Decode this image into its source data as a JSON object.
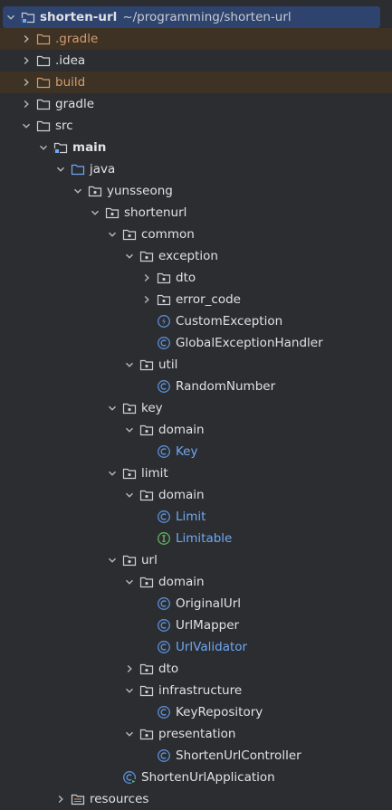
{
  "colors": {
    "background": "#2b2d30",
    "selected": "#2e436e",
    "excluded_row": "#3d3223",
    "excluded_text": "#d39c72",
    "modified_text": "#6fa8f5",
    "class_icon": "#5c8fd6",
    "interface_icon": "#5fb360"
  },
  "tree": {
    "root": {
      "label": "shorten-url",
      "path": "~/programming/shorten-url"
    },
    "gradle_dir": "gradle_dot",
    "items": {
      "gradle_hidden": ".gradle",
      "idea": ".idea",
      "build": "build",
      "gradle": "gradle",
      "src": "src",
      "main": "main",
      "java": "java",
      "yunsseong": "yunsseong",
      "shortenurl": "shortenurl",
      "common": "common",
      "exception": "exception",
      "dto_exc": "dto",
      "error_code": "error_code",
      "custom_exception": "CustomException",
      "global_exception_handler": "GlobalExceptionHandler",
      "util": "util",
      "random_number": "RandomNumber",
      "key": "key",
      "key_domain": "domain",
      "key_class": "Key",
      "limit": "limit",
      "limit_domain": "domain",
      "limit_class": "Limit",
      "limitable": "Limitable",
      "url": "url",
      "url_domain": "domain",
      "original_url": "OriginalUrl",
      "url_mapper": "UrlMapper",
      "url_validator": "UrlValidator",
      "url_dto": "dto",
      "infrastructure": "infrastructure",
      "key_repository": "KeyRepository",
      "presentation": "presentation",
      "shorten_url_controller": "ShortenUrlController",
      "shorten_url_application": "ShortenUrlApplication",
      "resources": "resources"
    }
  }
}
